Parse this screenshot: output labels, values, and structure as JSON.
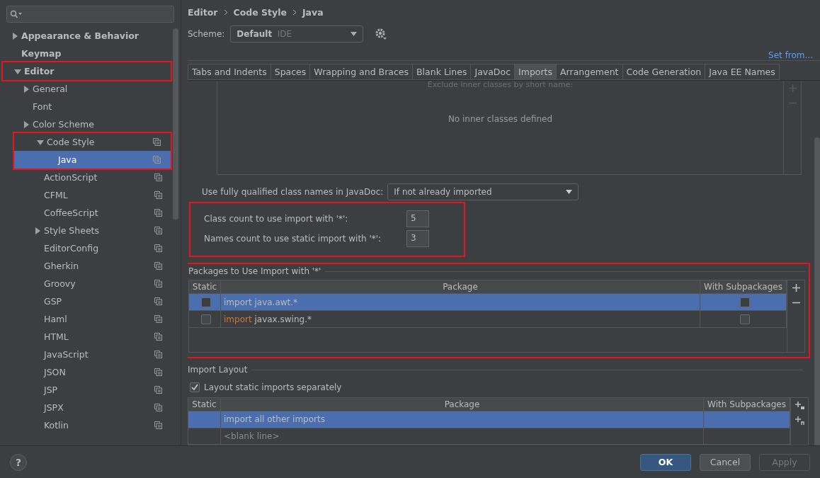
{
  "sidebar": {
    "tree": [
      {
        "label": "Appearance & Behavior",
        "bold": true,
        "expanded": false,
        "expandable": true,
        "selected": false,
        "highlight": false,
        "icon": false
      },
      {
        "label": "Keymap",
        "bold": true,
        "expanded": false,
        "expandable": false,
        "selected": false,
        "highlight": false,
        "icon": false
      },
      {
        "label": "Editor",
        "bold": true,
        "expanded": true,
        "expandable": true,
        "selected": false,
        "highlight": true,
        "icon": false,
        "children": [
          {
            "label": "General",
            "bold": false,
            "expanded": false,
            "expandable": true,
            "selected": false,
            "highlight": false,
            "icon": false
          },
          {
            "label": "Font",
            "bold": false,
            "expanded": false,
            "expandable": false,
            "selected": false,
            "highlight": false,
            "icon": false
          },
          {
            "label": "Color Scheme",
            "bold": false,
            "expanded": false,
            "expandable": true,
            "selected": false,
            "highlight": false,
            "icon": false
          },
          {
            "label": "Code Style",
            "bold": false,
            "expanded": true,
            "expandable": true,
            "selected": false,
            "highlight": true,
            "icon": true,
            "children": [
              {
                "label": "Java",
                "bold": false,
                "expanded": false,
                "expandable": false,
                "selected": true,
                "highlight": true,
                "icon": true
              },
              {
                "label": "ActionScript",
                "bold": false,
                "expanded": false,
                "expandable": false,
                "selected": false,
                "highlight": false,
                "icon": true
              },
              {
                "label": "CFML",
                "bold": false,
                "expanded": false,
                "expandable": false,
                "selected": false,
                "highlight": false,
                "icon": true
              },
              {
                "label": "CoffeeScript",
                "bold": false,
                "expanded": false,
                "expandable": false,
                "selected": false,
                "highlight": false,
                "icon": true
              },
              {
                "label": "Style Sheets",
                "bold": false,
                "expanded": false,
                "expandable": true,
                "selected": false,
                "highlight": false,
                "icon": true
              },
              {
                "label": "EditorConfig",
                "bold": false,
                "expanded": false,
                "expandable": false,
                "selected": false,
                "highlight": false,
                "icon": true
              },
              {
                "label": "Gherkin",
                "bold": false,
                "expanded": false,
                "expandable": false,
                "selected": false,
                "highlight": false,
                "icon": true
              },
              {
                "label": "Groovy",
                "bold": false,
                "expanded": false,
                "expandable": false,
                "selected": false,
                "highlight": false,
                "icon": true
              },
              {
                "label": "GSP",
                "bold": false,
                "expanded": false,
                "expandable": false,
                "selected": false,
                "highlight": false,
                "icon": true
              },
              {
                "label": "Haml",
                "bold": false,
                "expanded": false,
                "expandable": false,
                "selected": false,
                "highlight": false,
                "icon": true
              },
              {
                "label": "HTML",
                "bold": false,
                "expanded": false,
                "expandable": false,
                "selected": false,
                "highlight": false,
                "icon": true
              },
              {
                "label": "JavaScript",
                "bold": false,
                "expanded": false,
                "expandable": false,
                "selected": false,
                "highlight": false,
                "icon": true
              },
              {
                "label": "JSON",
                "bold": false,
                "expanded": false,
                "expandable": false,
                "selected": false,
                "highlight": false,
                "icon": true
              },
              {
                "label": "JSP",
                "bold": false,
                "expanded": false,
                "expandable": false,
                "selected": false,
                "highlight": false,
                "icon": true
              },
              {
                "label": "JSPX",
                "bold": false,
                "expanded": false,
                "expandable": false,
                "selected": false,
                "highlight": false,
                "icon": true
              },
              {
                "label": "Kotlin",
                "bold": false,
                "expanded": false,
                "expandable": false,
                "selected": false,
                "highlight": false,
                "icon": true
              }
            ]
          }
        ]
      }
    ]
  },
  "breadcrumb": [
    "Editor",
    "Code Style",
    "Java"
  ],
  "scheme": {
    "label": "Scheme:",
    "value": "Default",
    "note": "IDE"
  },
  "set_from_link": "Set from...",
  "tabs": [
    {
      "label": "Tabs and Indents",
      "selected": false
    },
    {
      "label": "Spaces",
      "selected": false
    },
    {
      "label": "Wrapping and Braces",
      "selected": false
    },
    {
      "label": "Blank Lines",
      "selected": false
    },
    {
      "label": "JavaDoc",
      "selected": false
    },
    {
      "label": "Imports",
      "selected": true
    },
    {
      "label": "Arrangement",
      "selected": false
    },
    {
      "label": "Code Generation",
      "selected": false
    },
    {
      "label": "Java EE Names",
      "selected": false
    }
  ],
  "inner_classes": {
    "caption": "Exclude inner classes by short name:",
    "empty_text": "No inner classes defined"
  },
  "javadoc": {
    "label": "Use fully qualified class names in JavaDoc:",
    "value": "If not already imported"
  },
  "counts": {
    "highlight": true,
    "rows": [
      {
        "label": "Class count to use import with '*':",
        "value": "5"
      },
      {
        "label": "Names count to use static import with '*':",
        "value": "3"
      }
    ]
  },
  "packages": {
    "title": "Packages to Use Import with '*'",
    "highlight": true,
    "columns": [
      "Static",
      "Package",
      "With Subpackages"
    ],
    "rows": [
      {
        "static": false,
        "keyword": "import",
        "name": "java.awt.*",
        "with_subpackages": false,
        "selected": true
      },
      {
        "static": false,
        "keyword": "import",
        "name": "javax.swing.*",
        "with_subpackages": false,
        "selected": false
      }
    ]
  },
  "import_layout": {
    "title": "Import Layout",
    "separate": {
      "label": "Layout static imports separately",
      "checked": true
    },
    "columns": [
      "Static",
      "Package",
      "With Subpackages"
    ],
    "rows": [
      {
        "text": "import all other imports",
        "kind": "entry",
        "selected": true
      },
      {
        "text": "<blank line>",
        "kind": "blank",
        "selected": false
      }
    ]
  },
  "help": "?",
  "buttons": [
    {
      "label": "OK",
      "kind": "default",
      "disabled": false
    },
    {
      "label": "Cancel",
      "kind": "normal",
      "disabled": false
    },
    {
      "label": "Apply",
      "kind": "normal",
      "disabled": true
    }
  ]
}
